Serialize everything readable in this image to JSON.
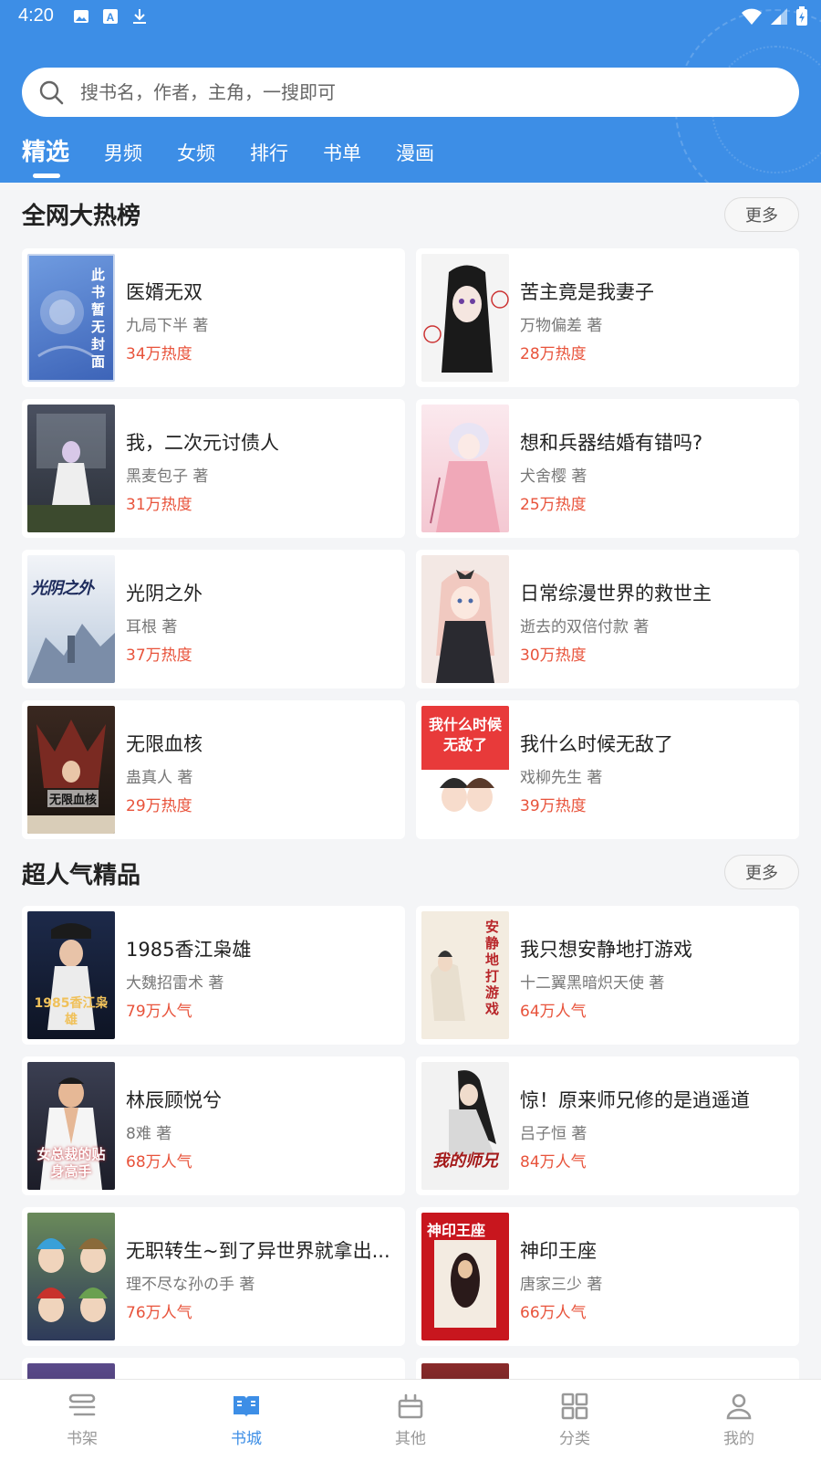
{
  "status_bar": {
    "time": "4:20"
  },
  "search": {
    "placeholder": "搜书名，作者，主角，一搜即可"
  },
  "tabs": [
    {
      "label": "精选",
      "active": true
    },
    {
      "label": "男频"
    },
    {
      "label": "女频"
    },
    {
      "label": "排行"
    },
    {
      "label": "书单"
    },
    {
      "label": "漫画"
    }
  ],
  "sections": [
    {
      "title": "全网大热榜",
      "more_label": "更多",
      "books": [
        {
          "title": "医婿无双",
          "author": "九局下半 著",
          "heat": "34万热度",
          "cover_text": "此书暂无封面"
        },
        {
          "title": "苦主竟是我妻子",
          "author": "万物偏差 著",
          "heat": "28万热度"
        },
        {
          "title": "我，二次元讨债人",
          "author": "黑麦包子 著",
          "heat": "31万热度"
        },
        {
          "title": "想和兵器结婚有错吗?",
          "author": "犬舍樱 著",
          "heat": "25万热度"
        },
        {
          "title": "光阴之外",
          "author": "耳根  著",
          "heat": "37万热度",
          "cover_text": "光阴之外"
        },
        {
          "title": "日常综漫世界的救世主",
          "author": "逝去的双倍付款 著",
          "heat": "30万热度"
        },
        {
          "title": "无限血核",
          "author": "蛊真人 著",
          "heat": "29万热度",
          "cover_text": "无限血核"
        },
        {
          "title": "我什么时候无敌了",
          "author": "戏柳先生 著",
          "heat": "39万热度",
          "cover_text": "我什么时候无敌了"
        }
      ]
    },
    {
      "title": "超人气精品",
      "more_label": "更多",
      "books": [
        {
          "title": "1985香江枭雄",
          "author": "大魏招雷术 著",
          "heat": "79万人气",
          "cover_text": "1985香江枭雄"
        },
        {
          "title": "我只想安静地打游戏",
          "author": "十二翼黑暗炽天使 著",
          "heat": "64万人气",
          "cover_text": "安静地打游戏"
        },
        {
          "title": "林辰顾悦兮",
          "author": "8难 著",
          "heat": "68万人气",
          "cover_text": "女总裁的贴身高手"
        },
        {
          "title": "惊！原来师兄修的是逍遥道",
          "author": "吕子恒 著",
          "heat": "84万人气",
          "cover_text": "我的师兄"
        },
        {
          "title": "无职转生~到了异世界就拿出...",
          "author": "理不尽な孙の手 著",
          "heat": "76万人气"
        },
        {
          "title": "神印王座",
          "author": "唐家三少 著",
          "heat": "66万人气",
          "cover_text": "神印王座"
        }
      ]
    }
  ],
  "bottom_nav": [
    {
      "label": "书架",
      "icon": "bookshelf-icon"
    },
    {
      "label": "书城",
      "icon": "book-store-icon",
      "active": true
    },
    {
      "label": "其他",
      "icon": "gift-icon"
    },
    {
      "label": "分类",
      "icon": "grid-icon"
    },
    {
      "label": "我的",
      "icon": "user-icon"
    }
  ],
  "colors": {
    "primary": "#3d8ee6",
    "heat": "#e8533b"
  }
}
